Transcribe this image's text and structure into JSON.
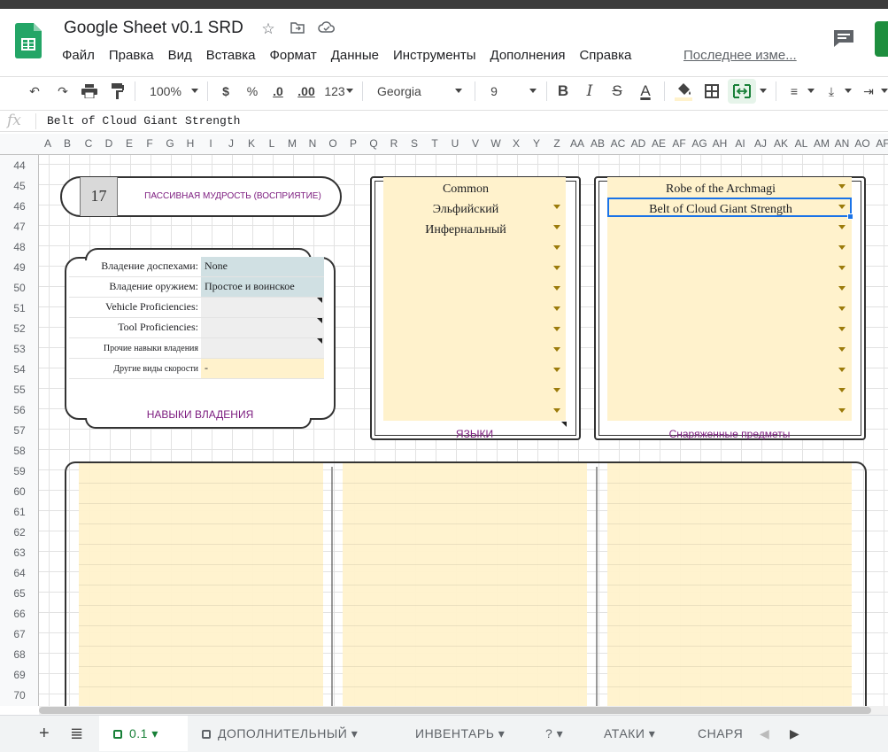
{
  "app": {
    "doc_title": "Google Sheet v0.1 SRD",
    "menu": [
      "Файл",
      "Правка",
      "Вид",
      "Вставка",
      "Формат",
      "Данные",
      "Инструменты",
      "Дополнения",
      "Справка"
    ],
    "last_edit": "Последнее изме..."
  },
  "toolbar": {
    "zoom": "100%",
    "currency": "$",
    "percent": "%",
    "dec_less": ".0",
    "dec_more": ".00",
    "format_more": "123",
    "font": "Georgia",
    "font_size": "9"
  },
  "formula_bar": {
    "fx": "fx",
    "value": "Belt of Cloud Giant Strength"
  },
  "columns": [
    "A",
    "B",
    "C",
    "D",
    "E",
    "F",
    "G",
    "H",
    "I",
    "J",
    "K",
    "L",
    "M",
    "N",
    "O",
    "P",
    "Q",
    "R",
    "S",
    "T",
    "U",
    "V",
    "W",
    "X",
    "Y",
    "Z",
    "AA",
    "AB",
    "AC",
    "AD",
    "AE",
    "AF",
    "AG",
    "AH",
    "AI",
    "AJ",
    "AK",
    "AL",
    "AM",
    "AN",
    "AO",
    "AF"
  ],
  "rows": [
    "44",
    "45",
    "46",
    "47",
    "48",
    "49",
    "50",
    "51",
    "52",
    "53",
    "54",
    "55",
    "56",
    "57",
    "58",
    "59",
    "60",
    "61",
    "62",
    "63",
    "64",
    "65",
    "66",
    "67",
    "68",
    "69",
    "70"
  ],
  "passive": {
    "value": "17",
    "label": "ПАССИВНАЯ МУДРОСТЬ (ВОСПРИЯТИЕ)"
  },
  "proficiencies": {
    "rows": [
      {
        "label": "Владение доспехами:",
        "value": "None"
      },
      {
        "label": "Владение оружием:",
        "value": "Простое и воинское"
      },
      {
        "label": "Vehicle Proficiencies:",
        "value": ""
      },
      {
        "label": "Tool Proficiencies:",
        "value": ""
      },
      {
        "label": "Прочие навыки владения",
        "value": ""
      },
      {
        "label": "Другие виды скорости",
        "value": "-"
      }
    ],
    "title": "НАВЫКИ ВЛАДЕНИЯ"
  },
  "languages": {
    "items": [
      "Common",
      "Эльфийский",
      "Инфернальный"
    ],
    "title": "ЯЗЫКИ"
  },
  "equipment": {
    "items": [
      "Robe of the Archmagi",
      "Belt of Cloud Giant Strength"
    ],
    "title": "Снаряженные предметы"
  },
  "sheet_tabs": {
    "add": "+",
    "active": "0.1",
    "tabs": [
      "ДОПОЛНИТЕЛЬНЫЙ",
      "ИНВЕНТАРЬ",
      "?",
      "АТАКИ",
      "СНАРЯ"
    ]
  },
  "colors": {
    "cell_yellow": "#fff2cc",
    "cell_blue": "#d0e0e3",
    "accent_purple": "#7b1a7e",
    "green": "#188038"
  }
}
